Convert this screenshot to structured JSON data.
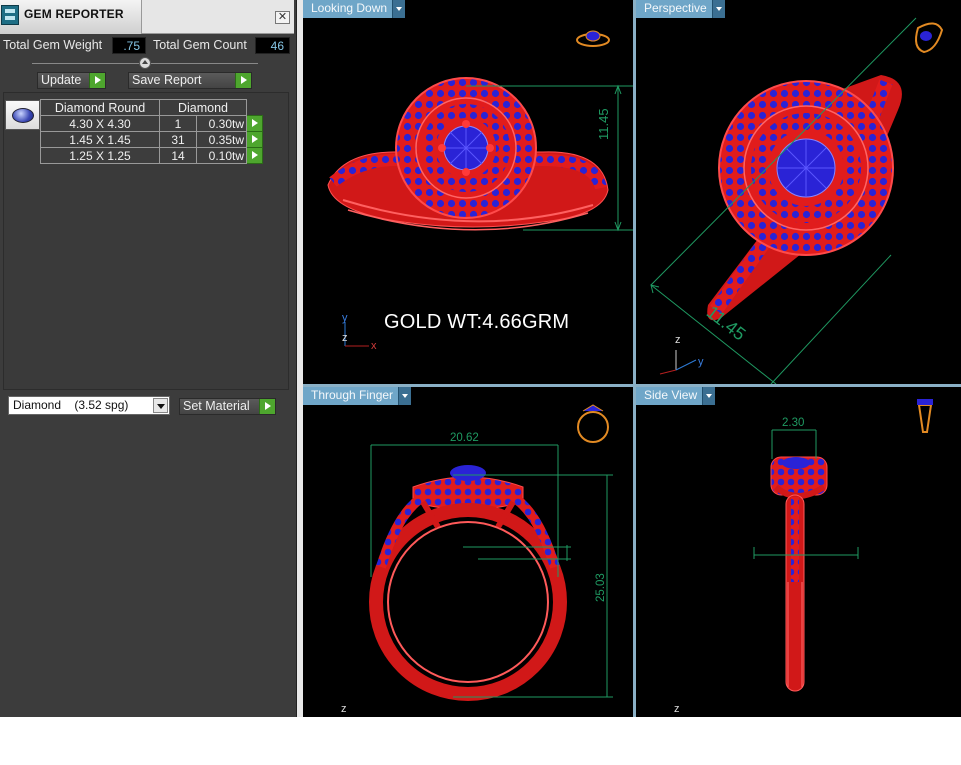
{
  "window": {
    "title": "GEM REPORTER",
    "close_glyph": "✕"
  },
  "summary": {
    "weight_label": "Total Gem Weight",
    "weight_value": ".75",
    "count_label": "Total Gem Count",
    "count_value": "46"
  },
  "buttons": {
    "update": "Update",
    "save_report": "Save Report",
    "set_material": "Set Material"
  },
  "gem_table": {
    "headers": [
      "Diamond Round",
      "Diamond"
    ],
    "rows": [
      {
        "size": "4.30 X 4.30",
        "count": "1",
        "weight": "0.30tw"
      },
      {
        "size": "1.45 X 1.45",
        "count": "31",
        "weight": "0.35tw"
      },
      {
        "size": "1.25 X 1.25",
        "count": "14",
        "weight": "0.10tw"
      }
    ]
  },
  "material": {
    "selected": "Diamond    (3.52 spg)"
  },
  "viewports": {
    "top_left": {
      "label": "Looking Down",
      "annotation": "GOLD WT:4.66GRM",
      "dimension": "11.45"
    },
    "top_right": {
      "label": "Perspective",
      "dimension": "11.45"
    },
    "bottom_left": {
      "label": "Through Finger",
      "width_dimension": "20.62",
      "height_dimension": "25.03"
    },
    "bottom_right": {
      "label": "Side View",
      "dimension": "2.30"
    }
  },
  "axes": {
    "x": "x",
    "y": "y",
    "z": "z"
  },
  "colors": {
    "metal": "#e11c1c",
    "gem": "#2a23d6",
    "dimension": "#1f9a62",
    "tab": "#6fa6c8",
    "go_button": "#4ea62e"
  }
}
